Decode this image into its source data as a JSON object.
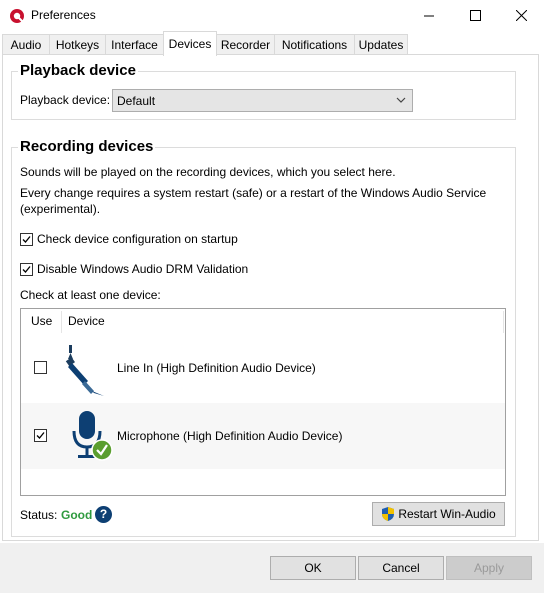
{
  "window": {
    "title": "Preferences"
  },
  "tabs": [
    {
      "label": "Audio"
    },
    {
      "label": "Hotkeys"
    },
    {
      "label": "Interface"
    },
    {
      "label": "Devices"
    },
    {
      "label": "Recorder"
    },
    {
      "label": "Notifications"
    },
    {
      "label": "Updates"
    }
  ],
  "playback": {
    "title": "Playback device",
    "label": "Playback device:",
    "value": "Default"
  },
  "recording": {
    "title": "Recording devices",
    "info1": "Sounds will be played on the recording devices, which you select here.",
    "info2": "Every change requires a system restart (safe) or a restart of the Windows Audio Service",
    "info3": "(experimental).",
    "check_config": "Check device configuration on startup",
    "disable_drm": "Disable Windows Audio DRM Validation",
    "check_hint": "Check at least one device:",
    "columns": {
      "use": "Use",
      "device": "Device"
    },
    "devices": [
      {
        "name": "Line In (High Definition Audio Device)",
        "checked": false,
        "icon": "audio-jack-icon"
      },
      {
        "name": "Microphone (High Definition Audio Device)",
        "checked": true,
        "icon": "microphone-icon"
      }
    ],
    "status_label": "Status:",
    "status_value": "Good",
    "help": "?",
    "restart_button": "Restart Win-Audio"
  },
  "footer": {
    "ok": "OK",
    "cancel": "Cancel",
    "apply": "Apply"
  },
  "colors": {
    "accent": "#0d3f73",
    "good": "#2e9a3e",
    "check_green": "#5a9e2f"
  }
}
